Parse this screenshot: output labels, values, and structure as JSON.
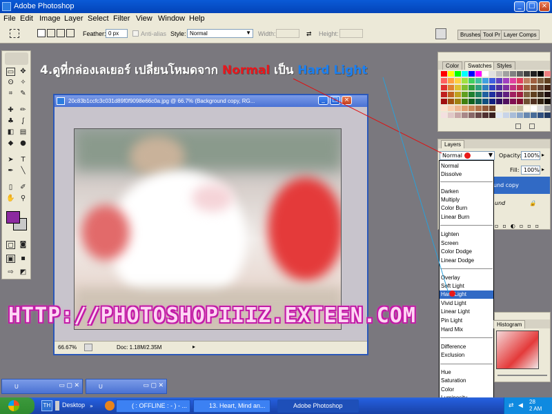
{
  "window": {
    "title": "Adobe Photoshop",
    "minimize": "_",
    "maximize": "□",
    "close": "×"
  },
  "menu": [
    "File",
    "Edit",
    "Image",
    "Layer",
    "Select",
    "Filter",
    "View",
    "Window",
    "Help"
  ],
  "options": {
    "feather_label": "Feather:",
    "feather_value": "0 px",
    "antialias": "Anti-alias",
    "style_label": "Style:",
    "style_value": "Normal",
    "width_label": "Width:",
    "height_label": "Height:"
  },
  "palette_well": [
    "Brushes",
    "Tool Pr",
    "Layer Comps"
  ],
  "document": {
    "title": "20c83b1ccfc3c031d89f0f9098e66c0a.jpg @ 66.7% (Background copy, RG...",
    "zoom": "66.67%",
    "doc_size": "Doc: 1.18M/2.35M"
  },
  "swatches_panel": {
    "tabs": [
      "Color",
      "Swatches",
      "Styles"
    ]
  },
  "layers_panel": {
    "tab": "Layers",
    "blend_mode": "Normal",
    "opacity_label": "Opacity:",
    "opacity_value": "100%",
    "fill_label": "Fill:",
    "fill_value": "100%",
    "layer1": "und copy",
    "layer2": "und"
  },
  "blend_modes": [
    "Normal",
    "Dissolve",
    "Darken",
    "Multiply",
    "Color Burn",
    "Linear Burn",
    "Lighten",
    "Screen",
    "Color Dodge",
    "Linear Dodge",
    "Overlay",
    "Soft Light",
    "Hard Light",
    "Vivid Light",
    "Linear Light",
    "Pin Light",
    "Hard Mix",
    "Difference",
    "Exclusion",
    "Hue",
    "Saturation",
    "Color",
    "Luminosity"
  ],
  "histogram_tab": "Histogram",
  "instruction": {
    "prefix": "4.ดูที่กล่องเลเยอร์ เปลี่ยนโหมดจาก ",
    "from": "Normal",
    "mid": " เป็น ",
    "to": "Hard Light"
  },
  "watermark": "HTTP://PHOTOSHOPIIIZ.EXTEEN.COM",
  "mini_windows": [
    "U",
    "U"
  ],
  "taskbar": {
    "lang": "TH",
    "desktop": "Desktop",
    "t1": "( : OFFLINE : - ) - ...",
    "t2": "13. Heart, Mind an...",
    "t3": "Adobe Photoshop",
    "clock": "2 AM",
    "date": "28"
  },
  "colors": {
    "foreground": "#8c2aa0",
    "background": "#c8c8c8",
    "highlight": "#316ac5"
  }
}
